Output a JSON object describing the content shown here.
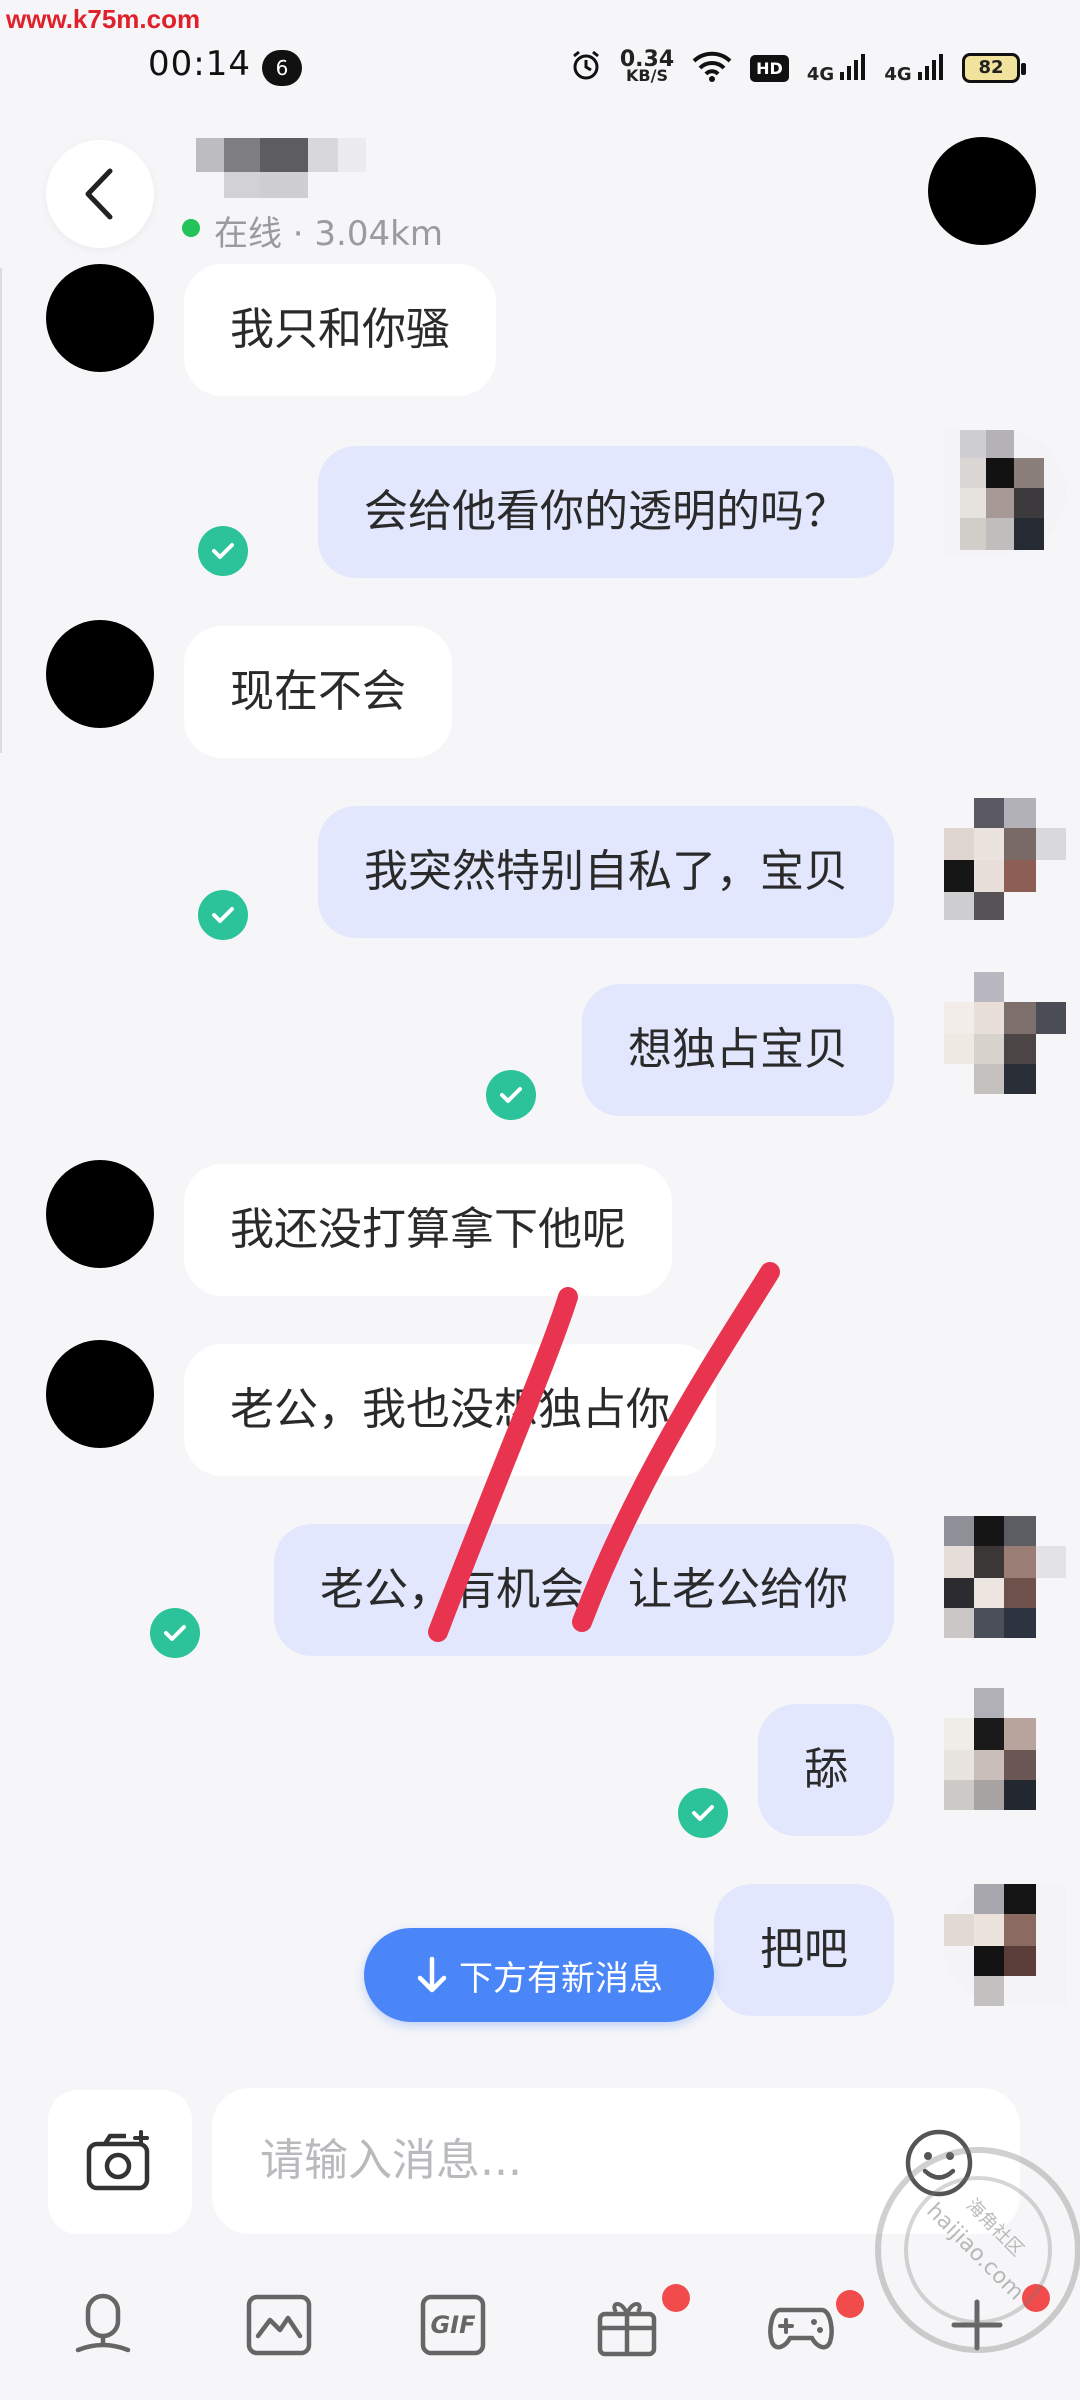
{
  "watermark": {
    "url": "www.k75m.com",
    "stamp_text": "haijiao.com",
    "stamp_cn": "海角社区"
  },
  "status_bar": {
    "time": "00:14",
    "notification_count": "6",
    "net_speed_value": "0.34",
    "net_speed_unit": "KB/S",
    "hd_label": "HD",
    "signal_1": "4G",
    "signal_2": "4G",
    "battery": "82"
  },
  "header": {
    "online_status": "在线 · 3.04km",
    "online_color": "#21c35a"
  },
  "messages": [
    {
      "direction": "in",
      "text": "我只和你骚"
    },
    {
      "direction": "out",
      "text": "会给他看你的透明的吗？",
      "read": true
    },
    {
      "direction": "in",
      "text": "现在不会"
    },
    {
      "direction": "out",
      "text": "我突然特别自私了，宝贝",
      "read": true
    },
    {
      "direction": "out",
      "text": "想独占宝贝",
      "read": true
    },
    {
      "direction": "in",
      "text": "我还没打算拿下他呢"
    },
    {
      "direction": "in",
      "text": "老公，我也没想独占你"
    },
    {
      "direction": "out",
      "text": "老公，有机会，让老公给你",
      "read": true
    },
    {
      "direction": "out",
      "text": "舔",
      "read": true
    },
    {
      "direction": "out",
      "text": "把吧"
    }
  ],
  "new_message_pill": {
    "label": "下方有新消息",
    "color": "#4a86f7"
  },
  "composer": {
    "placeholder": "请输入消息..."
  },
  "toolbar": {
    "items": [
      {
        "icon": "microphone-icon",
        "badge": false
      },
      {
        "icon": "image-icon",
        "badge": false
      },
      {
        "icon": "gif-icon",
        "label": "GIF",
        "badge": false
      },
      {
        "icon": "gift-icon",
        "badge": true
      },
      {
        "icon": "gamepad-icon",
        "badge": true
      },
      {
        "icon": "plus-icon",
        "badge": true
      }
    ]
  },
  "colors": {
    "background": "#f6f6f8",
    "outgoing_bubble": "#e2e7fd",
    "incoming_bubble": "#ffffff",
    "read_check": "#2cc39b",
    "badge_red": "#f24b4b",
    "scribble_red": "#e8344f"
  }
}
